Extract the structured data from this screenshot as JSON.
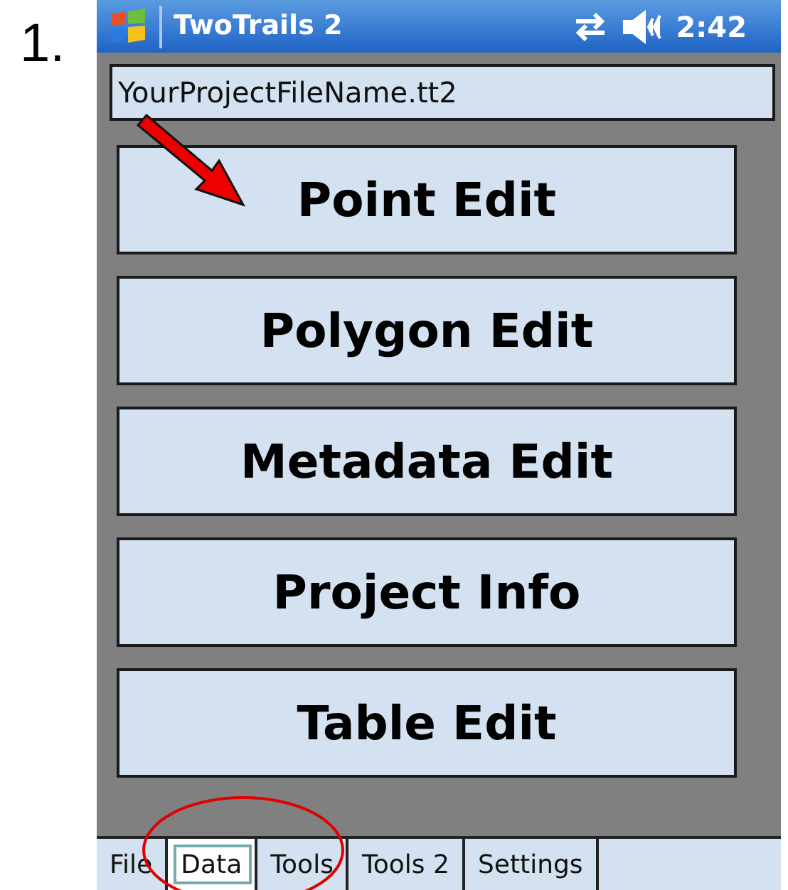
{
  "step_label": "1.",
  "title_bar": {
    "title": "TwoTrails 2",
    "time": "2:42"
  },
  "file_name": "YourProjectFileName.tt2",
  "buttons": [
    "Point Edit",
    "Polygon Edit",
    "Metadata Edit",
    "Project Info",
    "Table Edit"
  ],
  "tabs": [
    {
      "label": "File",
      "selected": false
    },
    {
      "label": "Data",
      "selected": true
    },
    {
      "label": "Tools",
      "selected": false
    },
    {
      "label": "Tools 2",
      "selected": false
    },
    {
      "label": "Settings",
      "selected": false
    }
  ]
}
